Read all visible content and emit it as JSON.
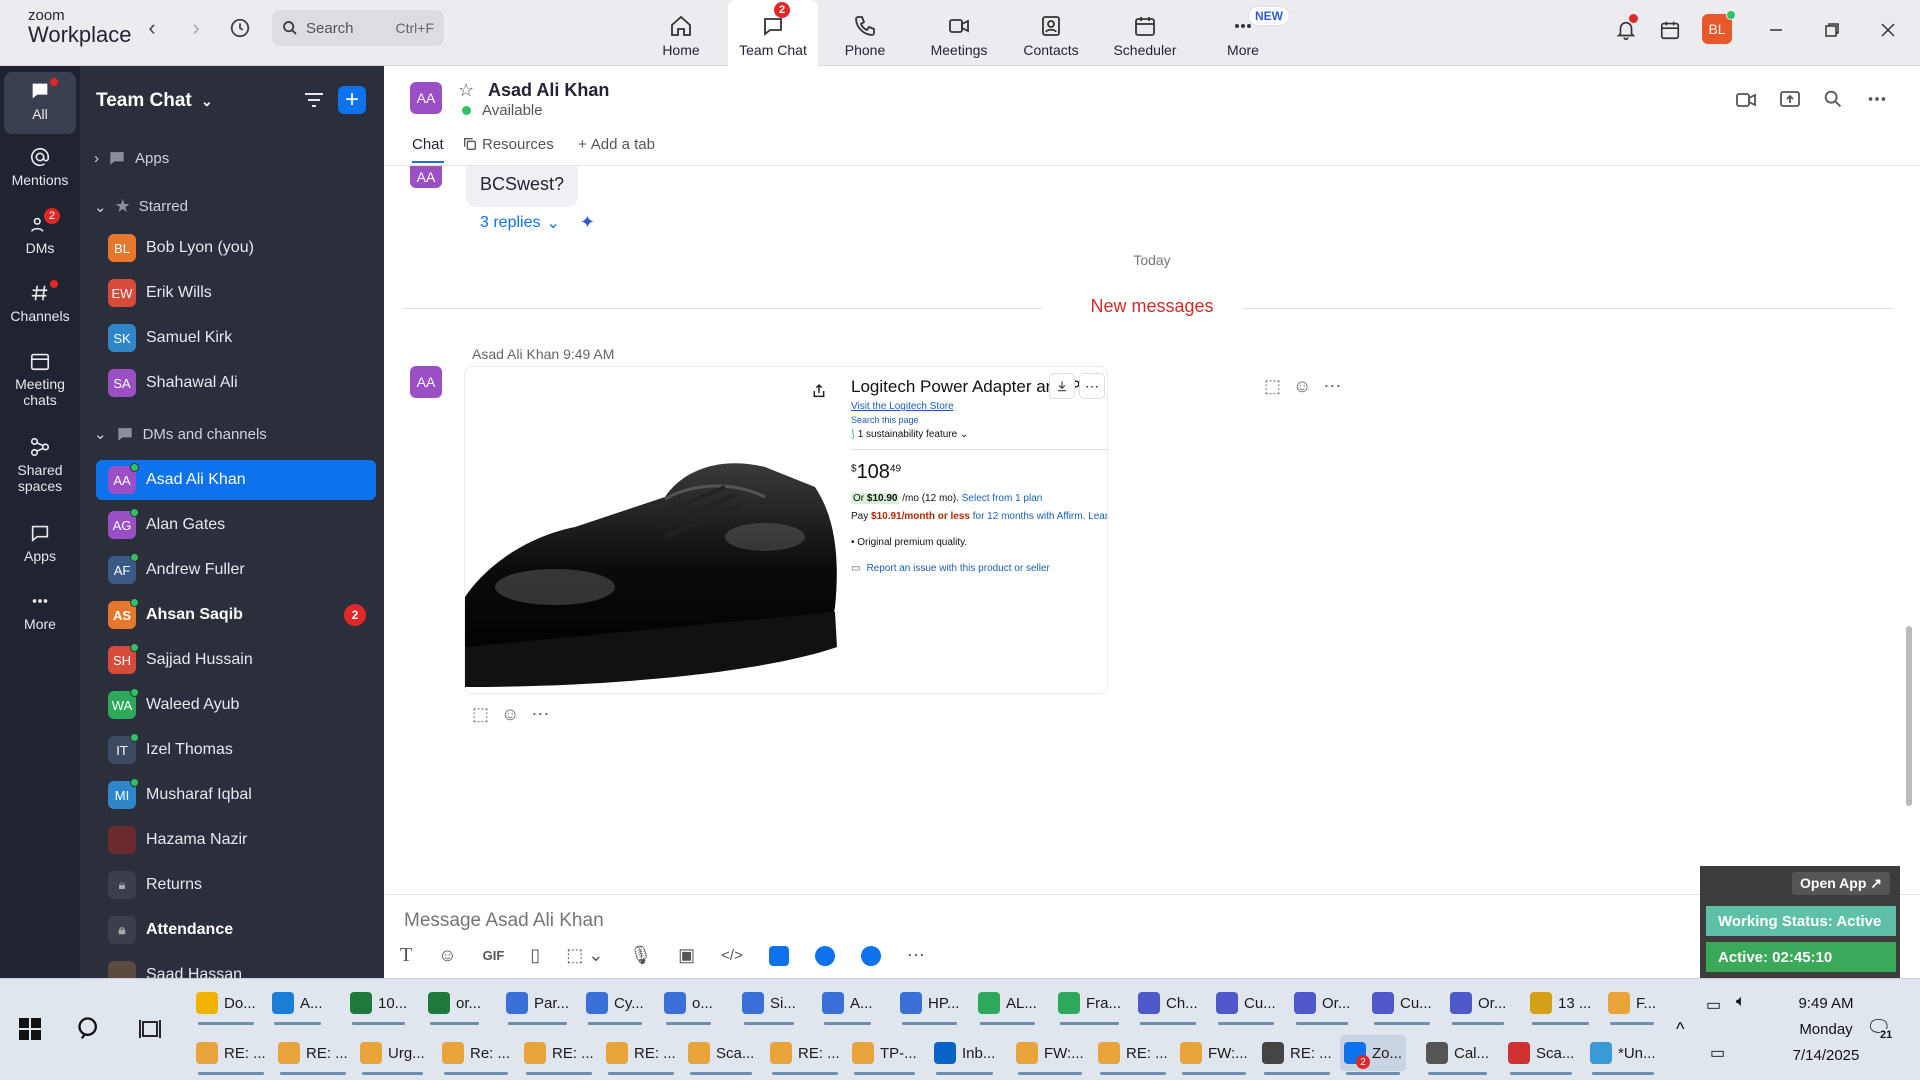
{
  "app": {
    "brand_top": "zoom",
    "brand_bottom": "Workplace"
  },
  "search": {
    "label": "Search",
    "shortcut": "Ctrl+F"
  },
  "top_tabs": [
    {
      "label": "Home",
      "icon": "home-icon"
    },
    {
      "label": "Team Chat",
      "icon": "chat-icon",
      "badge": "2",
      "active": true
    },
    {
      "label": "Phone",
      "icon": "phone-icon"
    },
    {
      "label": "Meetings",
      "icon": "video-icon"
    },
    {
      "label": "Contacts",
      "icon": "contacts-icon"
    },
    {
      "label": "Scheduler",
      "icon": "calendar-icon"
    },
    {
      "label": "More",
      "icon": "more-icon",
      "new_badge": "NEW"
    }
  ],
  "user_avatar": "BL",
  "rail": [
    {
      "label": "All",
      "icon": "chat-bubble-icon",
      "active": true
    },
    {
      "label": "Mentions",
      "icon": "at-icon"
    },
    {
      "label": "DMs",
      "icon": "people-icon",
      "badge": "2"
    },
    {
      "label": "Channels",
      "icon": "hash-icon"
    },
    {
      "label": "Meeting chats",
      "icon": "calendar-icon"
    },
    {
      "label": "Shared spaces",
      "icon": "share-icon"
    },
    {
      "label": "Apps",
      "icon": "apps-icon"
    },
    {
      "label": "More",
      "icon": "more-icon"
    }
  ],
  "sidebar": {
    "title": "Team Chat",
    "apps_label": "Apps",
    "starred_label": "Starred",
    "dms_label": "DMs and channels",
    "starred": [
      {
        "initials": "BL",
        "name": "Bob Lyon (you)",
        "color": "#e8772e"
      },
      {
        "initials": "EW",
        "name": "Erik Wills",
        "color": "#d84a3a"
      },
      {
        "initials": "SK",
        "name": "Samuel Kirk",
        "color": "#2f86c9"
      },
      {
        "initials": "SA",
        "name": "Shahawal Ali",
        "color": "#9b4fc4"
      }
    ],
    "contacts": [
      {
        "initials": "AA",
        "name": "Asad Ali Khan",
        "color": "#9b4fc4"
      },
      {
        "initials": "AG",
        "name": "Alan Gates",
        "color": "#9b4fc4"
      },
      {
        "initials": "AF",
        "name": "Andrew Fuller",
        "color": "#3b5a85"
      },
      {
        "initials": "AS",
        "name": "Ahsan Saqib",
        "color": "#e8772e",
        "unread": "2"
      },
      {
        "initials": "SH",
        "name": "Sajjad Hussain",
        "color": "#d84a3a"
      },
      {
        "initials": "WA",
        "name": "Waleed Ayub",
        "color": "#2ea85a"
      },
      {
        "initials": "IT",
        "name": "Izel Thomas",
        "color": "#3b4a60"
      },
      {
        "initials": "MI",
        "name": "Musharaf Iqbal",
        "color": "#2f86c9"
      },
      {
        "initials": "",
        "name": "Hazama Nazir",
        "color": "#6a2a30"
      },
      {
        "initials": "",
        "name": "Returns",
        "color": "#3a3f4b"
      },
      {
        "initials": "",
        "name": "Attendance",
        "color": "#3a3f4b"
      },
      {
        "initials": "",
        "name": "Saad Hassan",
        "color": "#5a4a40"
      }
    ]
  },
  "chat": {
    "avatar": "AA",
    "name": "Asad Ali Khan",
    "status": "Available",
    "tabs": {
      "chat": "Chat",
      "resources": "Resources",
      "add": "Add a tab"
    },
    "prev_message": "BCSwest?",
    "replies": "3 replies",
    "today": "Today",
    "new_messages": "New messages",
    "sender_line": "Asad Ali Khan",
    "time": "9:49 AM",
    "product": {
      "title": "Logitech Power Adapter and Pl",
      "title_end": "k",
      "store_link": "Visit the Logitech Store",
      "search_page": "Search this page",
      "sustainability": "1 sustainability feature",
      "price_sup": "$",
      "price": "108",
      "price_cents": "49",
      "or_label": "Or",
      "monthly": "$10.90",
      "monthly_rest": "/mo (12 mo).",
      "select_plan": "Select from 1 plan",
      "pay_prefix": "Pay",
      "pay_amount": "$10.91/month or less",
      "pay_suffix": "for 12 months with Affirm.",
      "learn_more": "Learn more",
      "bullet": "Original premium quality.",
      "report": "Report an issue with this product or seller"
    },
    "composer_placeholder": "Message Asad Ali Khan"
  },
  "widget": {
    "open_app": "Open App ↗",
    "status": "Working Status: Active",
    "active": "Active: 02:45:10"
  },
  "taskbar": {
    "row1": [
      {
        "label": "Do...",
        "color": "#f0b400"
      },
      {
        "label": "A...",
        "color": "#1a7fd4"
      },
      {
        "label": "10...",
        "color": "#1e7a3c"
      },
      {
        "label": "or...",
        "color": "#1e7a3c"
      },
      {
        "label": "Par...",
        "color": "#3a6fd8"
      },
      {
        "label": "Cy...",
        "color": "#3a6fd8"
      },
      {
        "label": "o...",
        "color": "#3a6fd8"
      },
      {
        "label": "Si...",
        "color": "#3a6fd8"
      },
      {
        "label": "A...",
        "color": "#3a6fd8"
      },
      {
        "label": "HP...",
        "color": "#3a6fd8"
      },
      {
        "label": "AL...",
        "color": "#2ea85a"
      },
      {
        "label": "Fra...",
        "color": "#2ea85a"
      },
      {
        "label": "Ch...",
        "color": "#5059c9"
      },
      {
        "label": "Cu...",
        "color": "#5059c9"
      },
      {
        "label": "Or...",
        "color": "#5059c9"
      },
      {
        "label": "Cu...",
        "color": "#5059c9"
      },
      {
        "label": "Or...",
        "color": "#5059c9"
      },
      {
        "label": "13 ...",
        "color": "#d4a017"
      },
      {
        "label": "F...",
        "color": "#e8a33a"
      }
    ],
    "row2": [
      {
        "label": "RE: ...",
        "color": "#e8a33a"
      },
      {
        "label": "RE: ...",
        "color": "#e8a33a"
      },
      {
        "label": "Urg...",
        "color": "#e8a33a"
      },
      {
        "label": "Re: ...",
        "color": "#e8a33a"
      },
      {
        "label": "RE: ...",
        "color": "#e8a33a"
      },
      {
        "label": "RE: ...",
        "color": "#e8a33a"
      },
      {
        "label": "Sca...",
        "color": "#e8a33a"
      },
      {
        "label": "RE: ...",
        "color": "#e8a33a"
      },
      {
        "label": "TP-...",
        "color": "#e8a33a"
      },
      {
        "label": "Inb...",
        "color": "#0a64c8"
      },
      {
        "label": "FW:...",
        "color": "#e8a33a"
      },
      {
        "label": "RE: ...",
        "color": "#e8a33a"
      },
      {
        "label": "FW:...",
        "color": "#e8a33a"
      },
      {
        "label": "RE: ...",
        "color": "#444444"
      },
      {
        "label": "Zo...",
        "color": "#0e72ed",
        "badge": "2"
      },
      {
        "label": "Cal...",
        "color": "#555555"
      },
      {
        "label": "Sca...",
        "color": "#d03030"
      },
      {
        "label": "*Un...",
        "color": "#3a9ad8"
      }
    ],
    "time": "9:49 AM",
    "day": "Monday",
    "date": "7/14/2025",
    "notif_count": "21"
  }
}
